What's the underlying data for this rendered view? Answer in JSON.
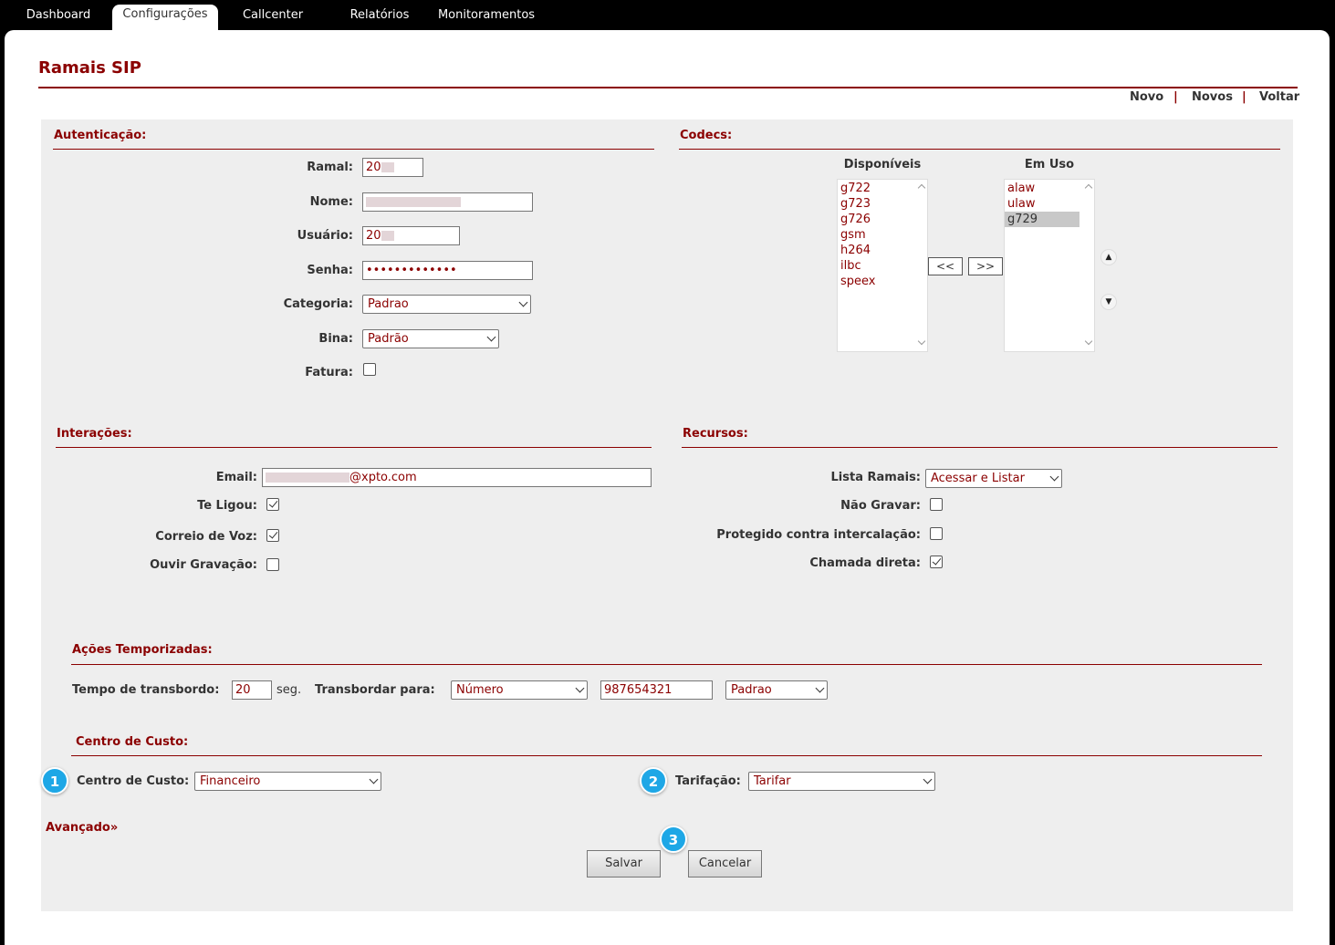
{
  "nav": {
    "tabs": [
      "Dashboard",
      "Configurações",
      "Callcenter",
      "Relatórios",
      "Monitoramentos"
    ],
    "active": "Configurações"
  },
  "page": {
    "title": "Ramais SIP",
    "links": [
      "Novo",
      "Novos",
      "Voltar"
    ],
    "separator": "|"
  },
  "autenticacao": {
    "title": "Autenticação:",
    "ramal_label": "Ramal:",
    "ramal_value": "20",
    "nome_label": "Nome:",
    "nome_value": "",
    "usuario_label": "Usuário:",
    "usuario_value": "20",
    "senha_label": "Senha:",
    "senha_value": "•••••••••••••",
    "categoria_label": "Categoria:",
    "categoria_value": "Padrao",
    "bina_label": "Bina:",
    "bina_value": "Padrão",
    "fatura_label": "Fatura:",
    "fatura_checked": false
  },
  "codecs": {
    "title": "Codecs:",
    "disponiveis_label": "Disponíveis",
    "em_uso_label": "Em Uso",
    "disponiveis": [
      "g722",
      "g723",
      "g726",
      "gsm",
      "h264",
      "ilbc",
      "speex"
    ],
    "em_uso": [
      "alaw",
      "ulaw",
      "g729"
    ],
    "em_uso_selected": "g729",
    "move_left": "<<",
    "move_right": ">>"
  },
  "interacoes": {
    "title": "Interações:",
    "email_label": "Email:",
    "email_value": "@xpto.com",
    "te_ligou_label": "Te Ligou:",
    "te_ligou": true,
    "correio_label": "Correio de Voz:",
    "correio": true,
    "ouvir_label": "Ouvir Gravação:",
    "ouvir": false
  },
  "recursos": {
    "title": "Recursos:",
    "lista_label": "Lista Ramais:",
    "lista_value": "Acessar e Listar",
    "nao_gravar_label": "Não Gravar:",
    "nao_gravar": false,
    "protegido_label": "Protegido contra intercalação:",
    "protegido": false,
    "chamada_label": "Chamada direta:",
    "chamada": true
  },
  "acoes": {
    "title": "Ações Temporizadas:",
    "tempo_label": "Tempo de transbordo:",
    "tempo_value": "20",
    "seg": "seg.",
    "transbordar_label": "Transbordar para:",
    "tipo_value": "Número",
    "numero_value": "987654321",
    "categoria_value": "Padrao"
  },
  "centro_custo": {
    "title": "Centro de Custo:",
    "centro_label": "Centro de Custo:",
    "centro_value": "Financeiro",
    "tarifacao_label": "Tarifação:",
    "tarifacao_value": "Tarifar"
  },
  "avancado": {
    "label": "Avançado",
    "arrow": "»"
  },
  "buttons": {
    "salvar": "Salvar",
    "cancelar": "Cancelar"
  },
  "badges": [
    "1",
    "2",
    "3"
  ],
  "colors": {
    "accent": "#8b0000",
    "badge": "#1ea7e6",
    "panel": "#eeeeee"
  }
}
